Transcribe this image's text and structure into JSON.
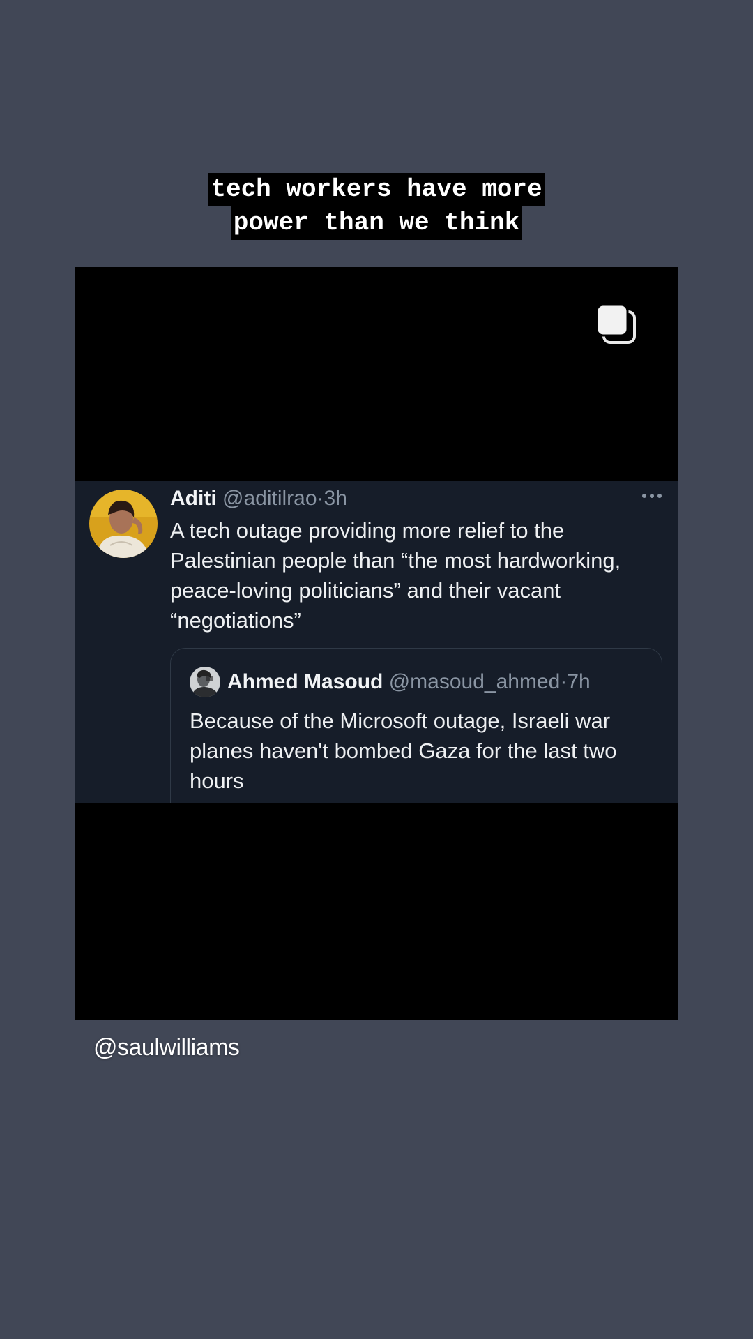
{
  "story": {
    "caption_lines": [
      "tech workers have more",
      "power than we think"
    ],
    "mention": "@saulwilliams"
  },
  "post": {
    "icon": "multiple-posts-icon"
  },
  "tweet": {
    "author_name": "Aditi",
    "author_handle": "@aditilrao",
    "separator": "·",
    "time": "3h",
    "text": "A tech outage providing more relief to the Palestinian people than “the most hardworking, peace-loving politicians” and their vacant “negotiations”",
    "more_icon": "more-options-icon",
    "quote": {
      "author_name": "Ahmed Masoud",
      "author_handle": "@masoud_ahmed",
      "separator": "·",
      "time": "7h",
      "text": "Because of the Microsoft outage, Israeli war planes haven't bombed Gaza for the last two hours"
    }
  },
  "colors": {
    "background": "#414756",
    "tweet_background": "#161d29",
    "caption_background": "#000000",
    "handle_gray": "#8a95a3"
  }
}
